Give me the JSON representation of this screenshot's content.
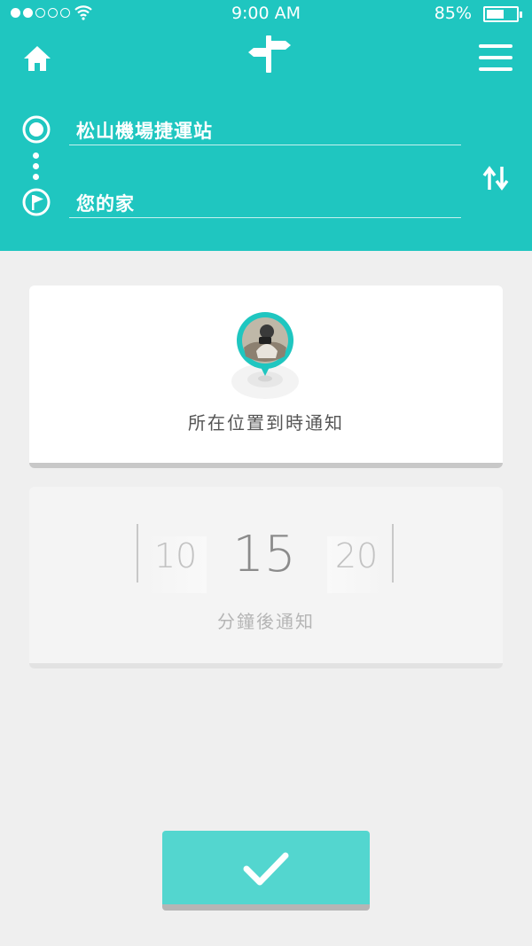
{
  "status_bar": {
    "time": "9:00  AM",
    "battery_percent": "85%",
    "battery_level": 0.6,
    "signal_bars_filled": 2,
    "signal_bars_total": 5
  },
  "header": {
    "home_icon": "home-icon",
    "logo_icon": "signpost-icon",
    "menu_icon": "hamburger-menu-icon",
    "origin": {
      "icon": "origin-circle-icon",
      "value": "松山機場捷運站"
    },
    "destination": {
      "icon": "flag-icon",
      "value": "您的家"
    },
    "swap_icon": "swap-arrows-icon"
  },
  "location_card": {
    "icon": "location-pin-avatar-icon",
    "label": "所在位置到時通知"
  },
  "time_card": {
    "options": [
      "10",
      "15",
      "20"
    ],
    "selected": "15",
    "label": "分鐘後通知"
  },
  "confirm_button": {
    "icon": "checkmark-icon"
  },
  "colors": {
    "primary": "#1fc6c0",
    "button": "#53d6cf",
    "background": "#efefef"
  }
}
